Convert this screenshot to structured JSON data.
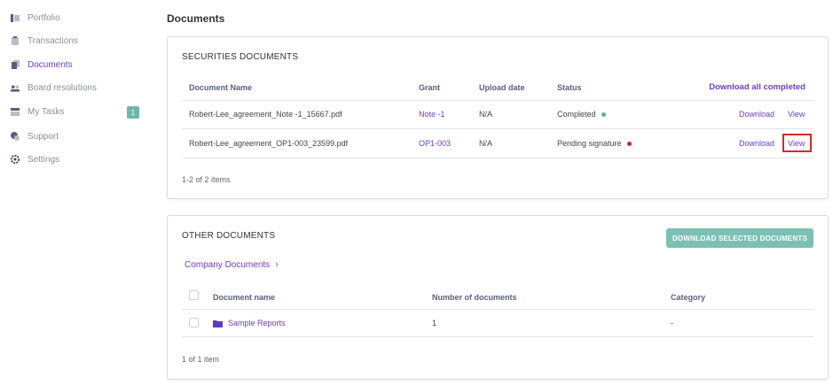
{
  "sidebar": {
    "items": [
      {
        "label": "Portfolio",
        "icon": "portfolio-icon"
      },
      {
        "label": "Transactions",
        "icon": "transactions-icon"
      },
      {
        "label": "Documents",
        "icon": "documents-icon",
        "active": true
      },
      {
        "label": "Board resolutions",
        "icon": "board-icon"
      },
      {
        "label": "My Tasks",
        "icon": "tasks-icon",
        "badge": "1"
      },
      {
        "label": "Support",
        "icon": "support-icon"
      },
      {
        "label": "Settings",
        "icon": "settings-icon"
      }
    ]
  },
  "page": {
    "title": "Documents"
  },
  "securities": {
    "title": "SECURITIES DOCUMENTS",
    "columns": {
      "name": "Document Name",
      "grant": "Grant",
      "upload": "Upload date",
      "status": "Status",
      "download_all": "Download all completed"
    },
    "rows": [
      {
        "name": "Robert-Lee_agreement_Note -1_15667.pdf",
        "grant": "Note -1",
        "upload": "N/A",
        "status": "Completed",
        "status_color": "#4fb3a0",
        "download": "Download",
        "view": "View"
      },
      {
        "name": "Robert-Lee_agreement_OP1-003_23599.pdf",
        "grant": "OP1-003",
        "upload": "N/A",
        "status": "Pending signature",
        "status_color": "#c62828",
        "download": "Download",
        "view": "View"
      }
    ],
    "footer": "1-2 of 2 items"
  },
  "other": {
    "title": "OTHER DOCUMENTS",
    "download_selected": "DOWNLOAD SELECTED DOCUMENTS",
    "breadcrumb": "Company Documents",
    "columns": {
      "name": "Document name",
      "count": "Number of documents",
      "category": "Category"
    },
    "rows": [
      {
        "name": "Sample Reports",
        "count": "1",
        "category": "-"
      }
    ],
    "footer": "1 of 1 item"
  },
  "colors": {
    "accent": "#6a3fc7",
    "teal": "#7cc0b4",
    "highlight": "#d22b2b"
  }
}
